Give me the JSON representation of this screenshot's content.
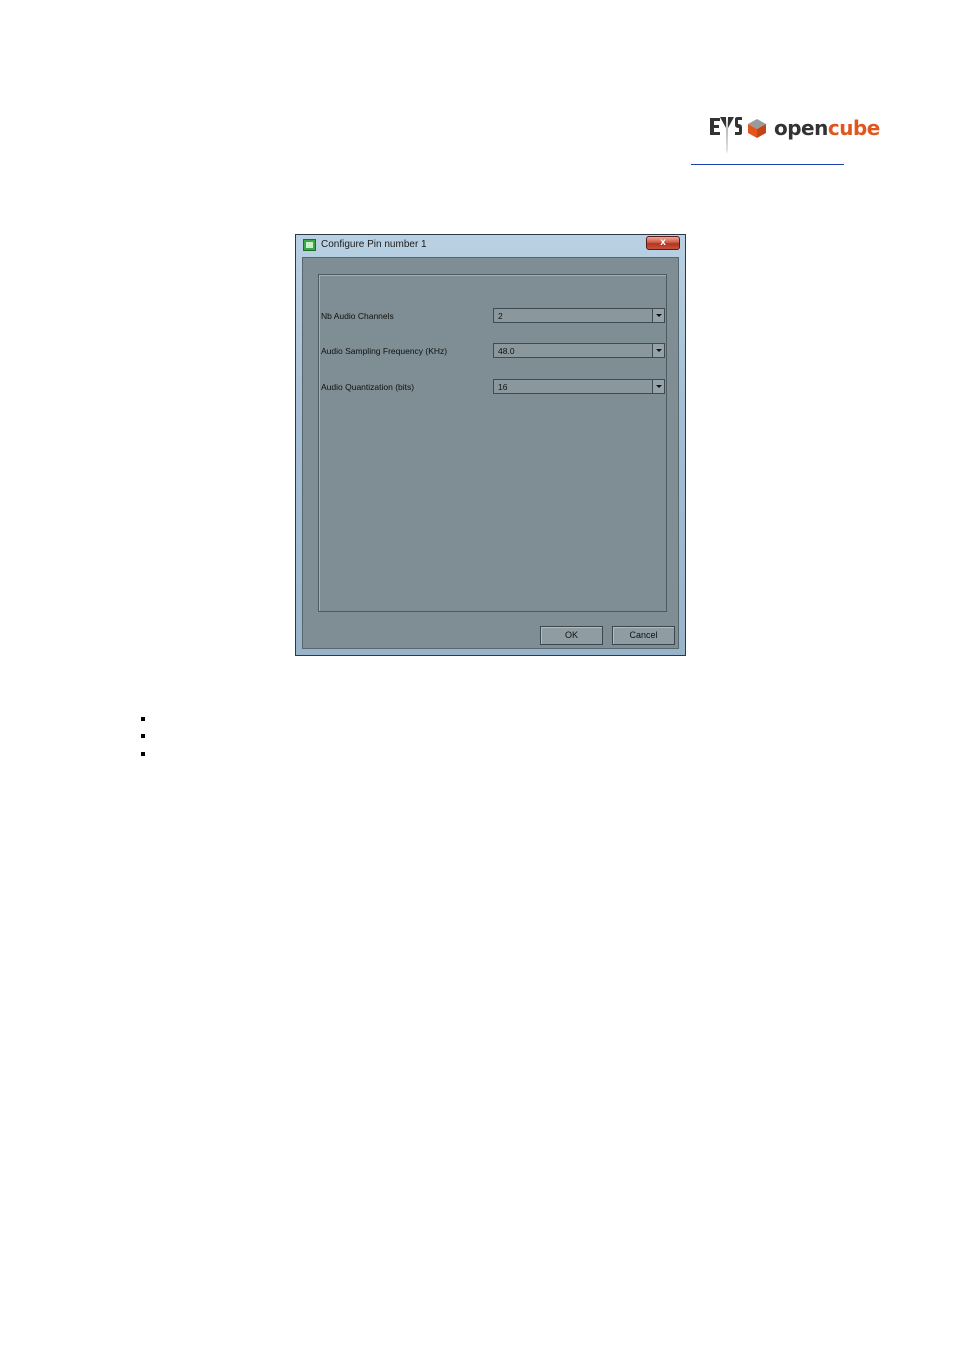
{
  "logo": {
    "wordmark_open": "open",
    "wordmark_cube": "cube",
    "emblem_text": "EVS",
    "colors": {
      "dark": "#333333",
      "accent": "#e2561e"
    }
  },
  "dialog": {
    "title": "Configure Pin number 1",
    "close_label": "x",
    "fields": [
      {
        "label": "Nb Audio Channels",
        "value": "2"
      },
      {
        "label": "Audio Sampling Frequency (KHz)",
        "value": "48.0"
      },
      {
        "label": "Audio Quantization (bits)",
        "value": "16"
      }
    ],
    "ok_label": "OK",
    "cancel_label": "Cancel"
  },
  "bullets": 3
}
